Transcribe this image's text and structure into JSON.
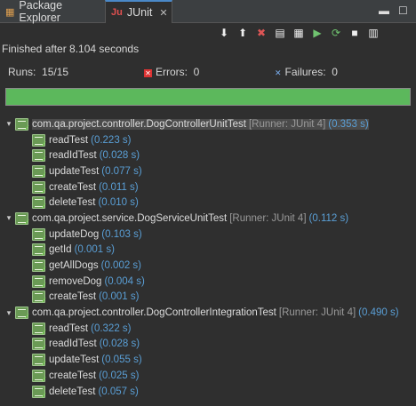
{
  "tabs": [
    {
      "label": "Package Explorer",
      "icon": "package-explorer-icon"
    },
    {
      "label": "JUnit",
      "icon": "junit-icon",
      "active": true
    }
  ],
  "toolbar": {
    "buttons": [
      {
        "name": "next-failure-button",
        "glyph": "⬇"
      },
      {
        "name": "previous-failure-button",
        "glyph": "⬆"
      },
      {
        "name": "show-failures-only-button",
        "glyph": "✖"
      },
      {
        "name": "scroll-lock-button",
        "glyph": "▤"
      },
      {
        "name": "test-run-history-button",
        "glyph": "▦"
      },
      {
        "name": "rerun-test-button",
        "glyph": "▶"
      },
      {
        "name": "rerun-failed-first-button",
        "glyph": "⟳"
      },
      {
        "name": "stop-button",
        "glyph": "■"
      },
      {
        "name": "history-button",
        "glyph": "▥"
      }
    ]
  },
  "status_text": "Finished after 8.104 seconds",
  "stats": {
    "runs_label": "Runs:",
    "runs_value": "15/15",
    "errors_label": "Errors:",
    "errors_value": "0",
    "failures_label": "Failures:",
    "failures_value": "0"
  },
  "progress": {
    "fraction": 1.0,
    "color": "#5cb85c"
  },
  "suites": [
    {
      "name": "com.qa.project.controller.DogControllerUnitTest",
      "runner": "[Runner: JUnit 4]",
      "time": "(0.353 s)",
      "selected": true,
      "tests": [
        {
          "name": "readTest",
          "time": "(0.223 s)"
        },
        {
          "name": "readIdTest",
          "time": "(0.028 s)"
        },
        {
          "name": "updateTest",
          "time": "(0.077 s)"
        },
        {
          "name": "createTest",
          "time": "(0.011 s)"
        },
        {
          "name": "deleteTest",
          "time": "(0.010 s)"
        }
      ]
    },
    {
      "name": "com.qa.project.service.DogServiceUnitTest",
      "runner": "[Runner: JUnit 4]",
      "time": "(0.112 s)",
      "selected": false,
      "tests": [
        {
          "name": "updateDog",
          "time": "(0.103 s)"
        },
        {
          "name": "getId",
          "time": "(0.001 s)"
        },
        {
          "name": "getAllDogs",
          "time": "(0.002 s)"
        },
        {
          "name": "removeDog",
          "time": "(0.004 s)"
        },
        {
          "name": "createTest",
          "time": "(0.001 s)"
        }
      ]
    },
    {
      "name": "com.qa.project.controller.DogControllerIntegrationTest",
      "runner": "[Runner: JUnit 4]",
      "time": "(0.490 s)",
      "selected": false,
      "tests": [
        {
          "name": "readTest",
          "time": "(0.322 s)"
        },
        {
          "name": "readIdTest",
          "time": "(0.028 s)"
        },
        {
          "name": "updateTest",
          "time": "(0.055 s)"
        },
        {
          "name": "createTest",
          "time": "(0.025 s)"
        },
        {
          "name": "deleteTest",
          "time": "(0.057 s)"
        }
      ]
    }
  ]
}
